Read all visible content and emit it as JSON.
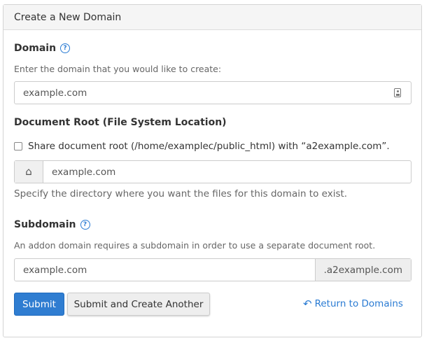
{
  "panel": {
    "title": "Create a New Domain"
  },
  "domain": {
    "label": "Domain",
    "help_glyph": "?",
    "hint": "Enter the domain that you would like to create:",
    "value": "example.com"
  },
  "document_root": {
    "label": "Document Root (File System Location)",
    "share_label": "Share document root (/home/examplec/public_html) with “a2example.com”.",
    "share_checked": false,
    "value": "example.com",
    "hint": "Specify the directory where you want the files for this domain to exist."
  },
  "subdomain": {
    "label": "Subdomain",
    "help_glyph": "?",
    "hint": "An addon domain requires a subdomain in order to use a separate document root.",
    "value": "example.com",
    "suffix": ".a2example.com"
  },
  "actions": {
    "submit_label": "Submit",
    "submit_another_label": "Submit and Create Another",
    "return_label": "Return to Domains"
  },
  "icons": {
    "help": "question-circle-icon",
    "contact_card": "id-card-icon",
    "home": "home-icon",
    "return": "reply-arrow-icon"
  },
  "colors": {
    "primary": "#2f7dd1",
    "link": "#2a7bd3",
    "border": "#cccccc",
    "heading_bg": "#f5f5f5"
  }
}
